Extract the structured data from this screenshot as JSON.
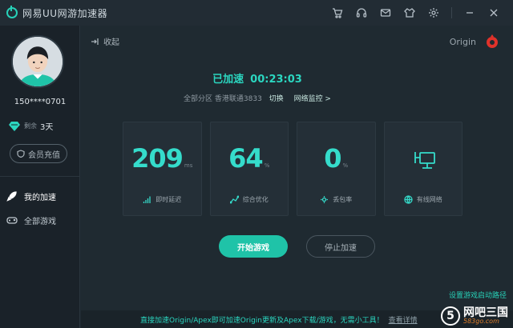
{
  "titlebar": {
    "app_title": "网易UU网游加速器",
    "icons": [
      "cart-icon",
      "headset-icon",
      "mail-icon",
      "skin-icon",
      "gear-icon",
      "minimize-icon",
      "close-icon"
    ]
  },
  "sidebar": {
    "phone": "150****0701",
    "vip_remain_label": "剩余",
    "vip_days": "3天",
    "recharge_label": "会员充值",
    "nav": [
      {
        "label": "我的加速",
        "icon": "rocket-icon",
        "active": true
      },
      {
        "label": "全部游戏",
        "icon": "gamepad-icon",
        "active": false
      }
    ]
  },
  "main": {
    "collapse_label": "收起",
    "game_name": "Origin",
    "status_label": "已加速",
    "elapsed": "00:23:03",
    "route_text": "全部分区 香港联通3833",
    "switch_label": "切换",
    "monitor_label": "网络监控 >",
    "cards": [
      {
        "value": "209",
        "unit": "ms",
        "label": "即时延迟",
        "icon": "bars-icon"
      },
      {
        "value": "64",
        "unit": "%",
        "label": "综合优化",
        "icon": "trend-icon"
      },
      {
        "value": "0",
        "unit": "%",
        "label": "丢包率",
        "icon": "gear-icon"
      },
      {
        "value": "",
        "unit": "",
        "label": "有线网络",
        "icon": "globe-icon"
      }
    ],
    "start_label": "开始游戏",
    "stop_label": "停止加速",
    "side_link": "设置游戏启动路径"
  },
  "banner": {
    "text": "直接加速Origin/Apex即可加速Origin更新及Apex下载/游戏，无需小工具！",
    "detail_label": "查看详情"
  },
  "watermark": {
    "name": "网吧三国",
    "url": "583go.com"
  },
  "colors": {
    "accent": "#2bd6c0",
    "background": "#1f2a31",
    "sidebar": "#1a2229"
  }
}
